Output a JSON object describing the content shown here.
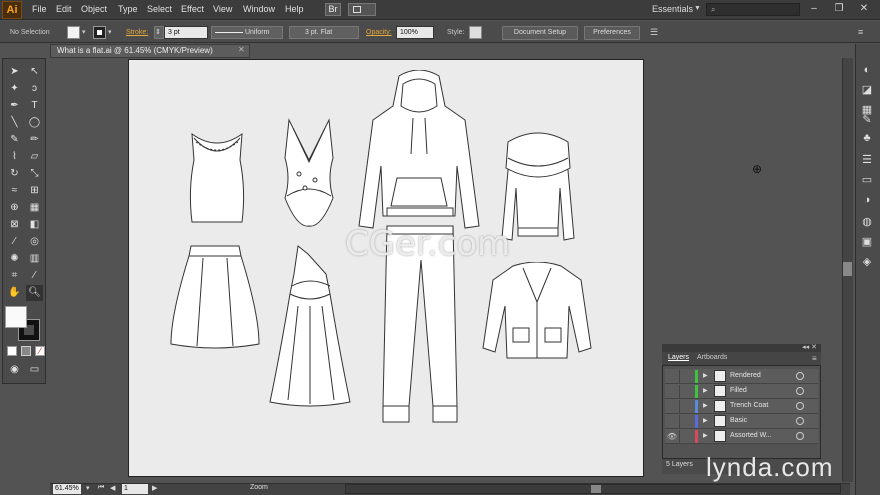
{
  "app": {
    "logo": "Ai"
  },
  "menu": [
    "File",
    "Edit",
    "Object",
    "Type",
    "Select",
    "Effect",
    "View",
    "Window",
    "Help"
  ],
  "topbar": {
    "bridge_label": "Br",
    "workspace": "Essentials"
  },
  "control": {
    "selection": "No Selection",
    "stroke_label": "Stroke:",
    "stroke_value": "3 pt",
    "profile": "Uniform",
    "brush": "3 pt. Flat",
    "opacity_label": "Opacity:",
    "opacity_value": "100%",
    "style_label": "Style:",
    "document_setup": "Document Setup",
    "preferences": "Preferences"
  },
  "document": {
    "tab_title": "What is a flat.ai @ 61.45% (CMYK/Preview)"
  },
  "status": {
    "zoom": "61.45%",
    "page": "1",
    "label": "Zoom"
  },
  "layers_panel": {
    "tabs": [
      "Layers",
      "Artboards"
    ],
    "layers": [
      {
        "name": "Rendered",
        "color": "#41c041",
        "visible": false
      },
      {
        "name": "Filled",
        "color": "#41c041",
        "visible": false
      },
      {
        "name": "Trench Coat",
        "color": "#5a8ad8",
        "visible": false
      },
      {
        "name": "Basic",
        "color": "#5a6ad8",
        "visible": false
      },
      {
        "name": "Assorted W...",
        "color": "#d84a5a",
        "visible": true
      }
    ],
    "count": "5 Layers"
  },
  "watermark": "CGer.com",
  "brand": "lynda.com"
}
